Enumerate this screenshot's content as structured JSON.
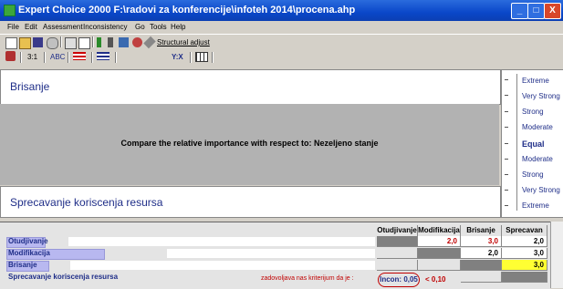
{
  "window": {
    "title": "Expert Choice 2000    F:\\radovi za konferencije\\infoteh 2014\\procena.ahp",
    "minimize": "_",
    "maximize": "□",
    "close": "X"
  },
  "menu": [
    "File",
    "Edit",
    "Assessment",
    "Inconsistency",
    "Go",
    "Tools",
    "Help"
  ],
  "toolbar": {
    "structural_adjust": "Structural adjust",
    "ratio_label": "3:1",
    "abc_label": "ABC",
    "yx_label": "Y:X"
  },
  "comparison": {
    "top_item": "Brisanje",
    "bottom_item": "Sprecavanje koriscenja resursa",
    "prompt": "Compare the relative importance  with respect to: Nezeljeno stanje"
  },
  "scale": {
    "labels": [
      "Extreme",
      "Very Strong",
      "Strong",
      "Moderate",
      "Equal",
      "Moderate",
      "Strong",
      "Very Strong",
      "Extreme"
    ],
    "selected": "Equal"
  },
  "matrix": {
    "headers": [
      "Otudjivanje",
      "Modifikacija",
      "Brisanje",
      "Sprecavan"
    ],
    "rows": [
      {
        "label": "Otudjivanje",
        "bar": 0.1,
        "cells": [
          "",
          "2,0",
          "3,0",
          "2,0"
        ]
      },
      {
        "label": "Modifikacija",
        "bar": 0.26,
        "cells": [
          "",
          "",
          "2,0",
          "3,0"
        ]
      },
      {
        "label": "Brisanje",
        "bar": 0.11,
        "cells": [
          "",
          "",
          "",
          "3,0"
        ]
      },
      {
        "label": "Sprecavanje koriscenja resursa",
        "bar": 0,
        "cells": [
          "",
          "",
          "",
          ""
        ]
      }
    ],
    "criterion_note": "zadovoljava nas kriterijum da je :",
    "inconsistency": "Incon: 0,05",
    "threshold": "< 0,10"
  },
  "colors": {
    "title_blue": "#0a47c9",
    "accent_red": "#c00000",
    "text_blue": "#1f2e88",
    "highlight_yellow": "#ffff33"
  }
}
